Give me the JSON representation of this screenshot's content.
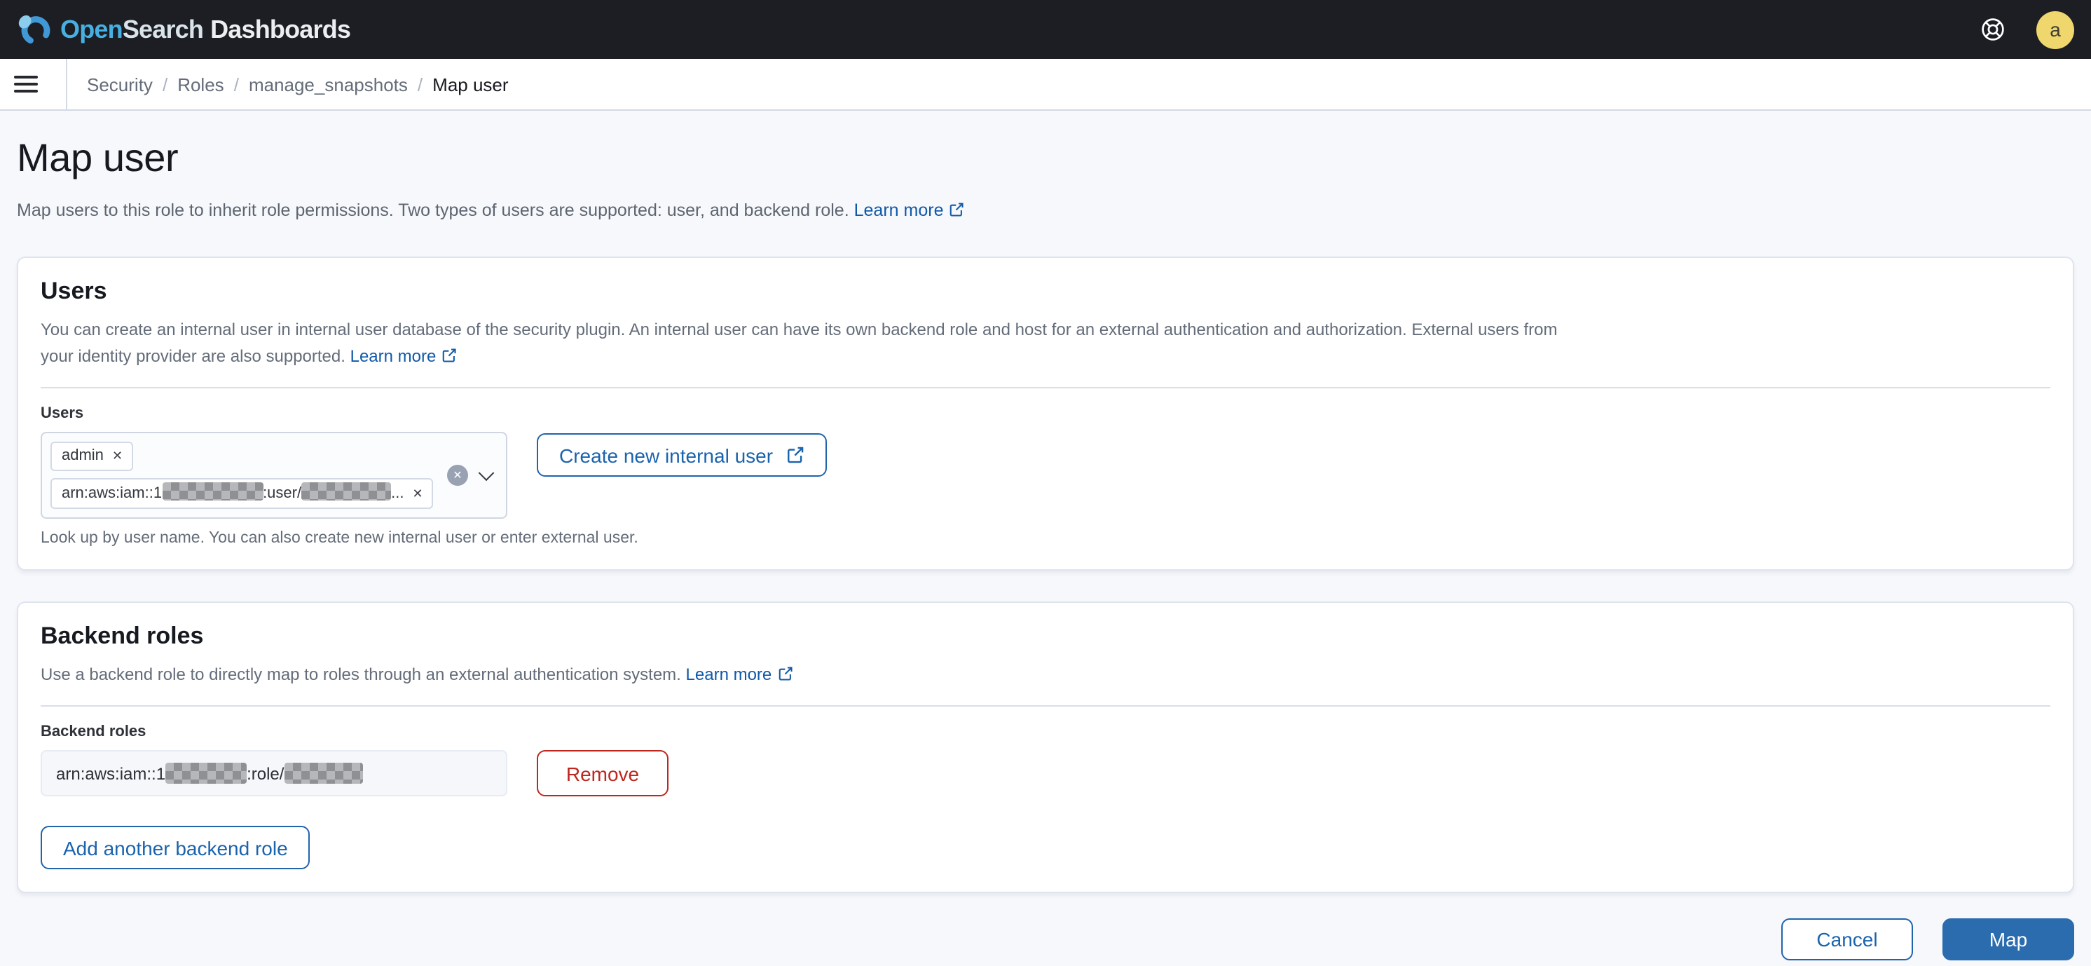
{
  "header": {
    "brand": {
      "open": "Open",
      "search": "Search",
      "product": "Dashboards"
    },
    "avatar_initial": "a"
  },
  "breadcrumbs": {
    "separator": "/",
    "items": [
      {
        "label": "Security"
      },
      {
        "label": "Roles"
      },
      {
        "label": "manage_snapshots"
      },
      {
        "label": "Map user"
      }
    ]
  },
  "page": {
    "title": "Map user",
    "description": "Map users to this role to inherit role permissions. Two types of users are supported: user, and backend role.",
    "learn_more": "Learn more"
  },
  "users_panel": {
    "title": "Users",
    "description": "You can create an internal user in internal user database of the security plugin. An internal user can have its own backend role and host for an external authentication and authorization. External users from your identity provider are also supported.",
    "learn_more": "Learn more",
    "field_label": "Users",
    "pill_admin": "admin",
    "arn_pill": {
      "prefix": "arn:aws:iam::1",
      "mid": ":user/",
      "suffix": "..."
    },
    "create_button": "Create new internal user",
    "helper": "Look up by user name. You can also create new internal user or enter external user."
  },
  "backend_panel": {
    "title": "Backend roles",
    "description": "Use a backend role to directly map to roles through an external authentication system.",
    "learn_more": "Learn more",
    "field_label": "Backend roles",
    "arn_input": {
      "prefix": "arn:aws:iam::1",
      "mid": ":role/"
    },
    "remove_button": "Remove",
    "add_button": "Add another backend role"
  },
  "footer": {
    "cancel": "Cancel",
    "map": "Map"
  },
  "colors": {
    "header_bg": "#1c1e23",
    "brand_blue": "#47b0e2",
    "link_blue": "#1059a9",
    "primary_outline": "#1f64ad",
    "primary_fill": "#2a6cae",
    "danger_red": "#bd271e",
    "avatar_yellow": "#f0d76d",
    "page_bg": "#f7f8fc"
  }
}
